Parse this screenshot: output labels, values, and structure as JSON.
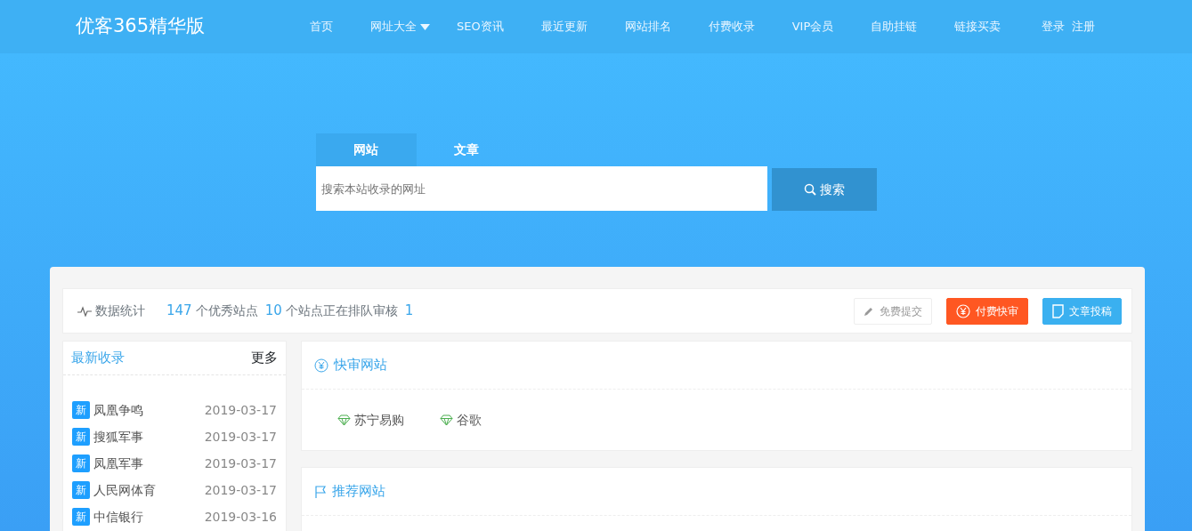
{
  "brand": "优客365精华版",
  "nav": [
    {
      "label": "首页",
      "dropdown": false
    },
    {
      "label": "网址大全",
      "dropdown": true
    },
    {
      "label": "SEO资讯",
      "dropdown": false
    },
    {
      "label": "最近更新",
      "dropdown": false
    },
    {
      "label": "网站排名",
      "dropdown": false
    },
    {
      "label": "付费收录",
      "dropdown": false
    },
    {
      "label": "VIP会员",
      "dropdown": false
    },
    {
      "label": "自助挂链",
      "dropdown": false
    },
    {
      "label": "链接买卖",
      "dropdown": false
    }
  ],
  "account": [
    "登录",
    "注册"
  ],
  "search": {
    "tabs": [
      {
        "label": "网站",
        "selected": true
      },
      {
        "label": "文章",
        "selected": false
      }
    ],
    "placeholder": "搜索本站收录的网址",
    "button": "搜索"
  },
  "stats": {
    "title": "数据统计",
    "items": [
      {
        "number": "147",
        "label": "个优秀站点"
      },
      {
        "number": "10",
        "label": "个站点正在排队审核"
      },
      {
        "number": "1"
      }
    ],
    "buttons": [
      {
        "kind": "free",
        "label": "免费提交"
      },
      {
        "kind": "paid",
        "label": "付费快审"
      },
      {
        "kind": "article",
        "label": "文章投稿"
      }
    ]
  },
  "latest": {
    "title": "最新收录",
    "more": "更多",
    "items": [
      {
        "badge": "新",
        "name": "凤凰争鸣",
        "date": "2019-03-17"
      },
      {
        "badge": "新",
        "name": "搜狐军事",
        "date": "2019-03-17"
      },
      {
        "badge": "新",
        "name": "凤凰军事",
        "date": "2019-03-17"
      },
      {
        "badge": "新",
        "name": "人民网体育",
        "date": "2019-03-17"
      },
      {
        "badge": "新",
        "name": "中信银行",
        "date": "2019-03-16"
      }
    ]
  },
  "panels": [
    {
      "kind": "fast",
      "title": "快审网站",
      "sites": [
        "苏宁易购",
        "谷歌"
      ]
    },
    {
      "kind": "recommend",
      "title": "推荐网站"
    }
  ]
}
